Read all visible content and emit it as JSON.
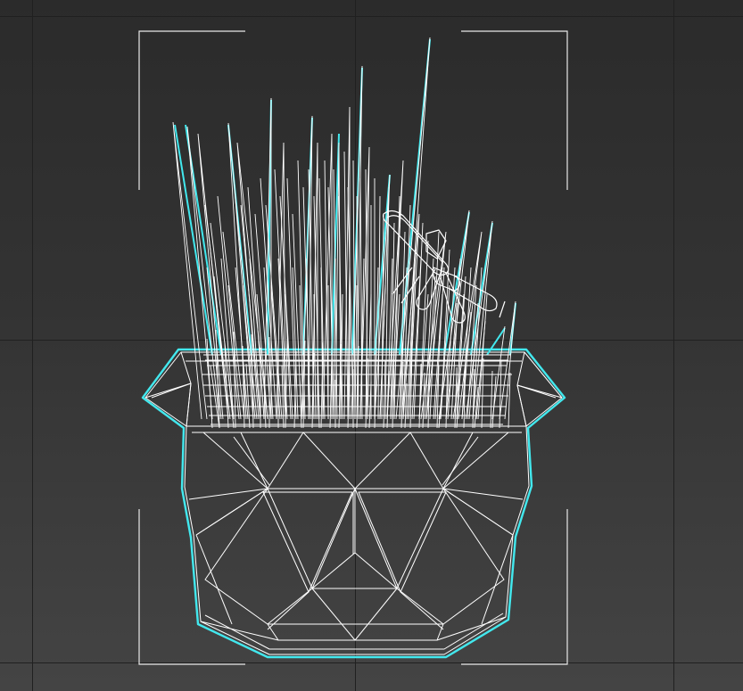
{
  "viewport": {
    "background_top": "#2b2b2b",
    "background_bottom": "#444444",
    "grid_color": "#202020",
    "wire_color": "#ffffff",
    "selection_color": "#42e8ee",
    "bracket_color": "#e8e8e8"
  },
  "scene": {
    "object": "potted-grass-plant",
    "display_mode": "wireframe",
    "selected": true
  }
}
